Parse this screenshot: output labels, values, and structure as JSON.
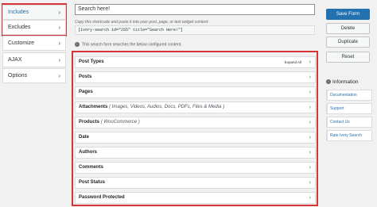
{
  "sidebar": {
    "items": [
      {
        "label": "Includes"
      },
      {
        "label": "Excludes"
      },
      {
        "label": "Customize"
      },
      {
        "label": "AJAX"
      },
      {
        "label": "Options"
      }
    ],
    "chevron": "›"
  },
  "search": {
    "value": "Search here!"
  },
  "shortcode": {
    "hint": "Copy this shortcode and paste it into your post, page, or text widget content:",
    "code": "[ivory-search id=\"255\" title=\"Search Here!\"]"
  },
  "notice": {
    "text": "This search form searches the below configured content."
  },
  "criteria": {
    "expand_all": "Expand All",
    "rows": [
      {
        "label": "Post Types",
        "sub": ""
      },
      {
        "label": "Posts",
        "sub": ""
      },
      {
        "label": "Pages",
        "sub": ""
      },
      {
        "label": "Attachments",
        "sub": "( Images, Videos, Audios, Docs, PDFs, Files & Media )"
      },
      {
        "label": "Products",
        "sub": "( WooCommerce )"
      },
      {
        "label": "Date",
        "sub": ""
      },
      {
        "label": "Authors",
        "sub": ""
      },
      {
        "label": "Comments",
        "sub": ""
      },
      {
        "label": "Post Status",
        "sub": ""
      },
      {
        "label": "Password Protected",
        "sub": ""
      }
    ]
  },
  "actions": {
    "save": "Save Form",
    "delete": "Delete",
    "duplicate": "Duplicate",
    "reset": "Reset"
  },
  "info": {
    "title": "Information",
    "links": [
      {
        "label": "Documentation"
      },
      {
        "label": "Support"
      },
      {
        "label": "Contact Us"
      },
      {
        "label": "Rate Ivory Search"
      }
    ]
  },
  "colors": {
    "accent": "#2271b1",
    "highlight_border": "#d63638"
  }
}
